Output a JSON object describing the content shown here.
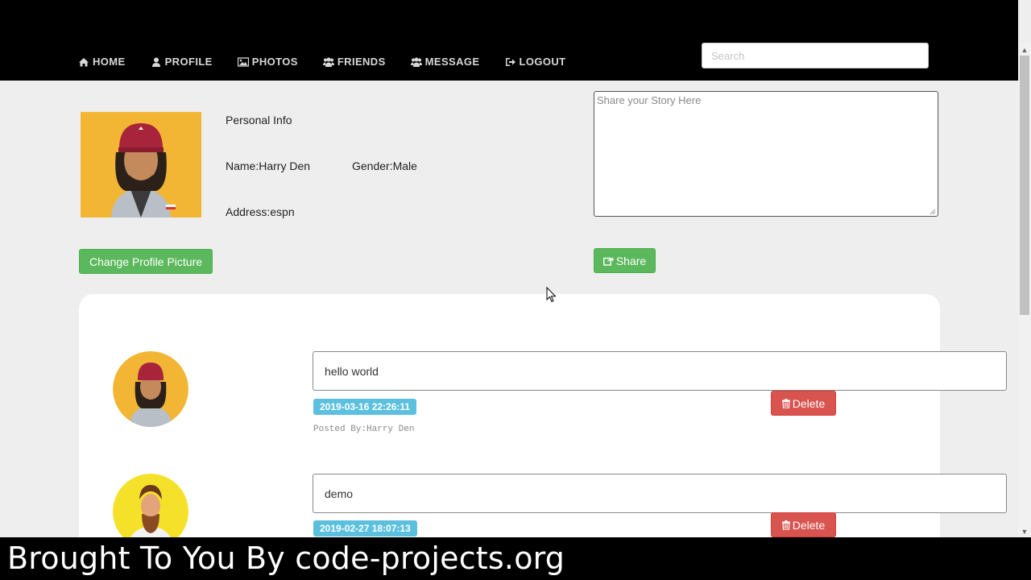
{
  "nav": {
    "items": [
      {
        "label": "HOME",
        "icon": "home-icon"
      },
      {
        "label": "PROFILE",
        "icon": "user-icon"
      },
      {
        "label": "PHOTOS",
        "icon": "photo-icon"
      },
      {
        "label": "FRIENDS",
        "icon": "users-icon"
      },
      {
        "label": "MESSAGE",
        "icon": "users-icon"
      },
      {
        "label": "LOGOUT",
        "icon": "sign-out-icon"
      }
    ],
    "search_placeholder": "Search"
  },
  "profile": {
    "section_title": "Personal Info",
    "name": "Name:Harry Den",
    "gender": "Gender:Male",
    "address": "Address:espn",
    "change_picture_label": "Change Profile Picture"
  },
  "composer": {
    "placeholder": "Share your Story Here",
    "share_label": "Share"
  },
  "posts": [
    {
      "text": "hello world",
      "date": "2019-03-16 22:26:11",
      "posted_by": "Posted By:Harry Den",
      "delete_label": "Delete"
    },
    {
      "text": "demo",
      "date": "2019-02-27 18:07:13",
      "delete_label": "Delete"
    }
  ],
  "banner": {
    "text": "Brought To You By code-projects.org"
  },
  "colors": {
    "topbar": "#000000",
    "success": "#5cb85c",
    "danger": "#d9534f",
    "info": "#5bc0de",
    "background": "#eeeeee"
  }
}
